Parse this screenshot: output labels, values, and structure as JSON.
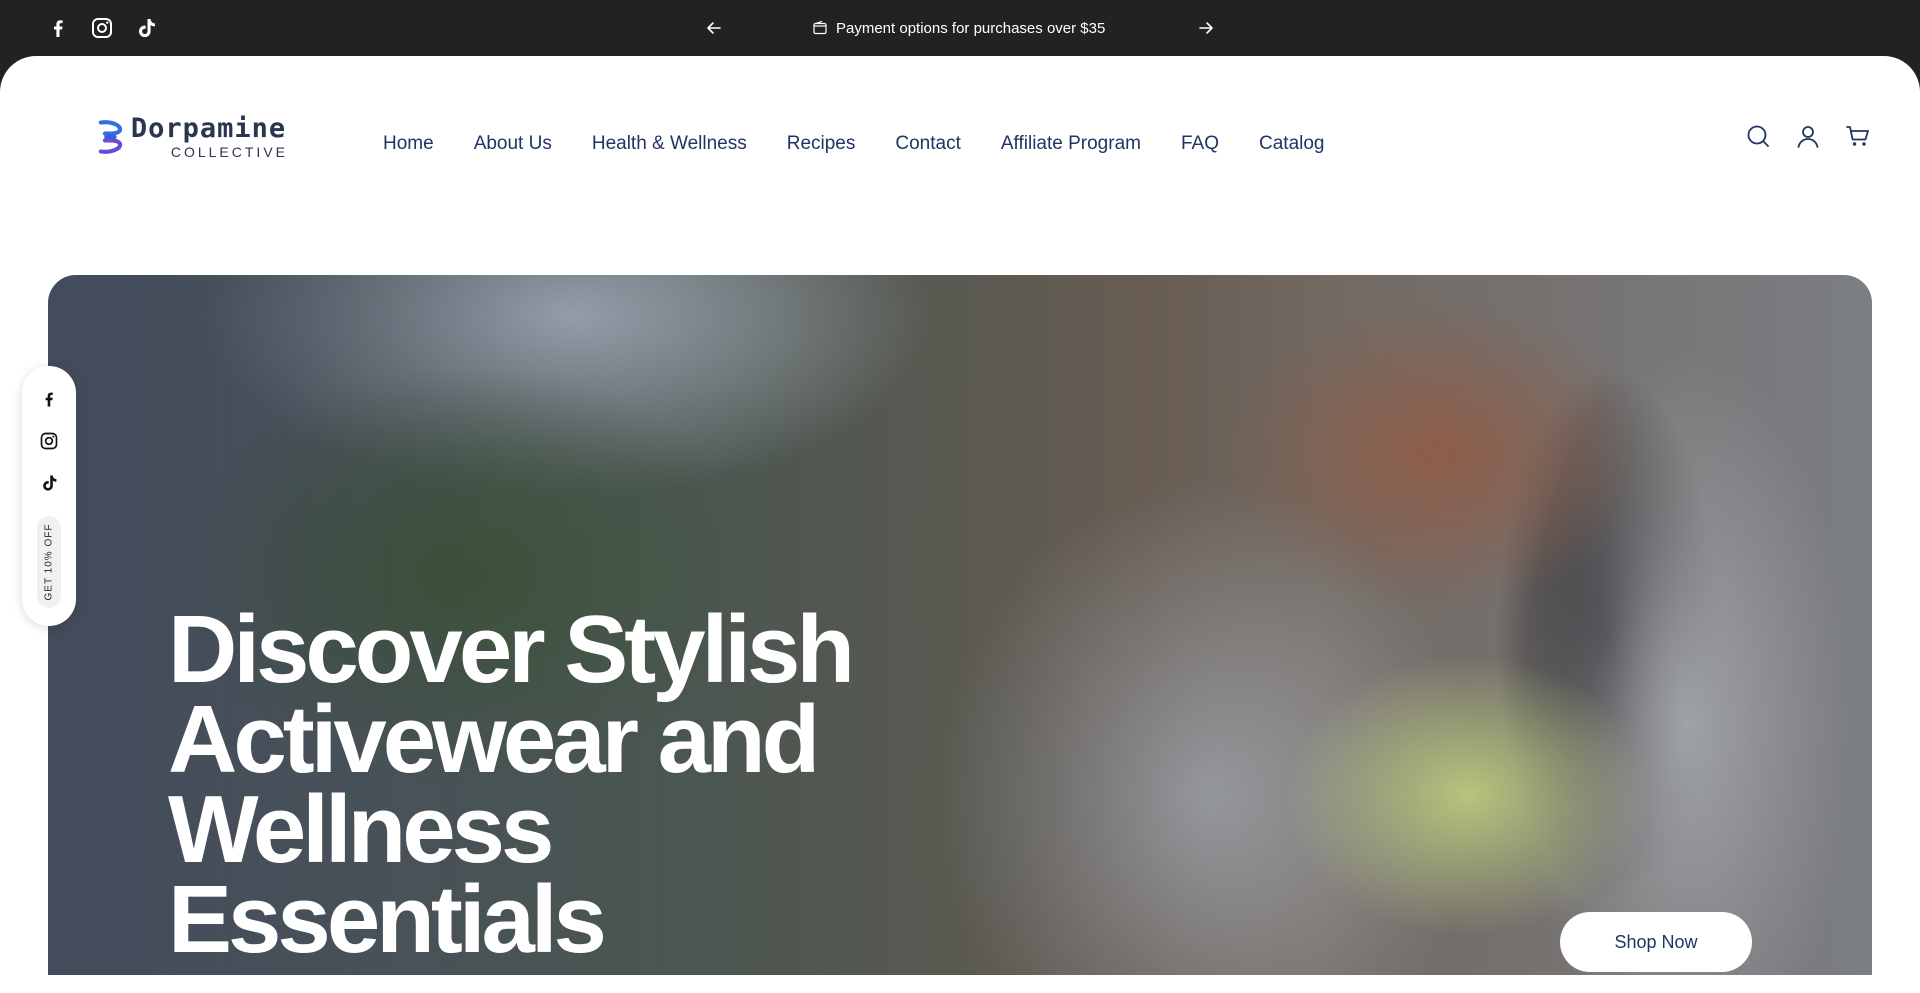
{
  "announcement": {
    "message": "Payment options for purchases over $35",
    "socials": [
      "facebook-icon",
      "instagram-icon",
      "tiktok-icon"
    ],
    "prev_icon": "arrow-left-icon",
    "next_icon": "arrow-right-icon",
    "message_icon": "wallet-icon"
  },
  "header": {
    "logo": {
      "name": "Dorpamine",
      "tagline": "COLLECTIVE"
    },
    "nav": [
      {
        "label": "Home"
      },
      {
        "label": "About Us"
      },
      {
        "label": "Health & Wellness"
      },
      {
        "label": "Recipes"
      },
      {
        "label": "Contact"
      },
      {
        "label": "Affiliate Program"
      },
      {
        "label": "FAQ"
      },
      {
        "label": "Catalog"
      }
    ],
    "icons": [
      "search-icon",
      "account-icon",
      "cart-icon"
    ]
  },
  "hero": {
    "title_lines": [
      "Discover Stylish",
      "Activewear and",
      "Wellness",
      "Essentials"
    ],
    "cta_label": "Shop Now"
  },
  "side_float": {
    "socials": [
      "facebook-icon",
      "instagram-icon",
      "tiktok-icon"
    ],
    "promo_label": "GET 10% OFF"
  },
  "colors": {
    "announcement_bg": "#222222",
    "nav_text": "#1f3563",
    "logo_blue": "#2f6fe0",
    "logo_purple": "#6a4ad6"
  }
}
